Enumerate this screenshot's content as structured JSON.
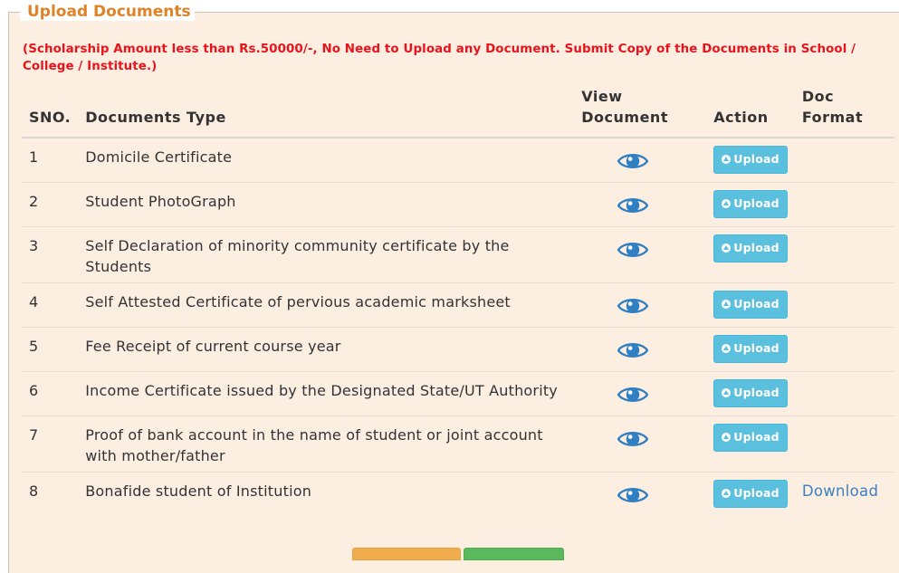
{
  "legend": "Upload Documents",
  "notice": "(Scholarship Amount less than Rs.50000/-, No Need to Upload any Document. Submit Copy of the Documents in School / College / Institute.)",
  "headers": {
    "sno": "SNO.",
    "type": "Documents Type",
    "view_line1": "View",
    "view_line2": "Document",
    "action": "Action",
    "format_line1": "Doc",
    "format_line2": "Format"
  },
  "rows": [
    {
      "sno": "1",
      "type": "Domicile Certificate",
      "action": "Upload",
      "format": ""
    },
    {
      "sno": "2",
      "type": "Student PhotoGraph",
      "action": "Upload",
      "format": ""
    },
    {
      "sno": "3",
      "type": "Self Declaration of minority community certificate by the Students",
      "action": "Upload",
      "format": ""
    },
    {
      "sno": "4",
      "type": "Self Attested Certificate of pervious academic marksheet",
      "action": "Upload",
      "format": ""
    },
    {
      "sno": "5",
      "type": "Fee Receipt of current course year",
      "action": "Upload",
      "format": ""
    },
    {
      "sno": "6",
      "type": "Income Certificate issued by the Designated State/UT Authority",
      "action": "Upload",
      "format": ""
    },
    {
      "sno": "7",
      "type": "Proof of bank account in the name of student or joint account with mother/father",
      "action": "Upload",
      "format": ""
    },
    {
      "sno": "8",
      "type": "Bonafide student of Institution",
      "action": "Upload",
      "format": "Download"
    }
  ],
  "icons": {
    "view": "eye-icon",
    "upload": "circle-arrow-up-icon"
  },
  "colors": {
    "legend": "#e08326",
    "notice": "#e8141c",
    "panel_bg": "#fdeee2",
    "upload_button": "#5bc0de",
    "eye_icon": "#2f7fc1",
    "download_link": "#3a7fc1"
  }
}
